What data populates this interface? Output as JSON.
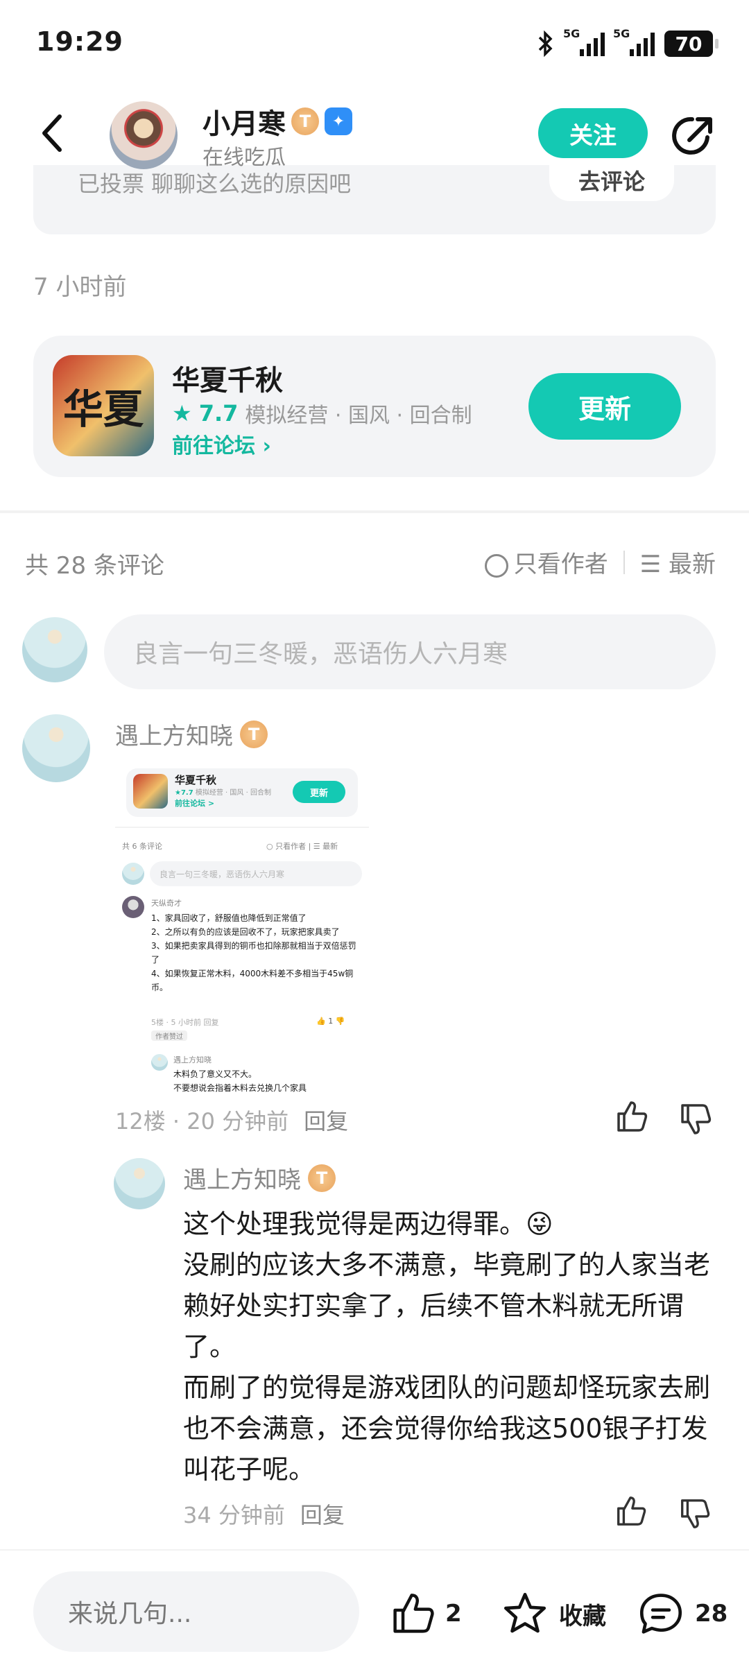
{
  "status": {
    "time": "19:29",
    "network1": "5G",
    "network2": "5G",
    "battery": "70"
  },
  "header": {
    "name": "小月寒",
    "level": "5",
    "subtitle": "在线吃瓜",
    "follow": "关注"
  },
  "prev_card": {
    "left_text": "已投票  聊聊这么选的原因吧",
    "right_text": "去评论"
  },
  "post_time": "7 小时前",
  "game": {
    "title": "华夏千秋",
    "score": "7.7",
    "tags": "模拟经营 · 国风 · 回合制",
    "forum": "前往论坛",
    "update": "更新",
    "icon_text": "华夏"
  },
  "comments_header": {
    "count": "共 28 条评论",
    "author_only": "只看作者",
    "sort": "最新"
  },
  "input_placeholder": "良言一句三冬暖，恶语伤人六月寒",
  "comment1": {
    "name": "遇上方知晓",
    "level": "4",
    "meta_floor": "12楼 · 20 分钟前",
    "reply": "回复",
    "thumbnail": {
      "game_title": "华夏千秋",
      "score": "★7.7",
      "tags": "模拟经营 · 国风 · 回合制",
      "forum": "前往论坛 >",
      "update": "更新",
      "count": "共 6 条评论",
      "author_only": "只看作者",
      "sort": "最新",
      "placeholder": "良言一句三冬暖，恶语伤人六月寒",
      "user": "天纵奇才",
      "lines": [
        "1、家具回收了，舒服值也降低到正常值了",
        "2、之所以有负的应该是回收不了，玩家把家具卖了",
        "3、如果把卖家具得到的铜币也扣除那就相当于双倍惩罚了",
        "4、如果恢复正常木料，4000木料差不多相当于45w铜币。"
      ],
      "meta": "5楼 · 5 小时前  回复",
      "like": "1",
      "author_tag": "作者赞过",
      "sub_user": "遇上方知晓",
      "sub_text": "木料负了意义又不大。",
      "sub_text2": "不要想说会指着木料去兑换几个家具"
    }
  },
  "reply1": {
    "name": "遇上方知晓",
    "level": "4",
    "text": "这个处理我觉得是两边得罪。😜\n没刷的应该大多不满意，毕竟刷了的人家当老赖好处实打实拿了，后续不管木料就无所谓了。\n而刷了的觉得是游戏团队的问题却怪玩家去刷也不会满意，还会觉得你给我这500银子打发叫花子呢。",
    "meta": "34 分钟前",
    "reply": "回复"
  },
  "bottom": {
    "placeholder": "来说几句...",
    "likes": "2",
    "favorite": "收藏",
    "comments": "28"
  },
  "colors": {
    "accent": "#14c9b3",
    "text": "#1a1a1a",
    "muted": "#888888"
  }
}
